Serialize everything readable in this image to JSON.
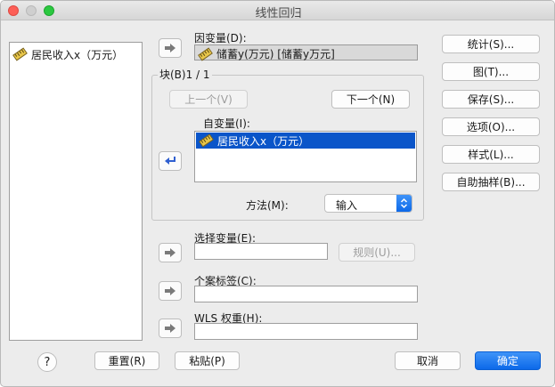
{
  "window": {
    "title": "线性回归"
  },
  "variable_list": {
    "items": [
      {
        "label": "居民收入x（万元）",
        "icon": "scale-ruler-icon"
      }
    ]
  },
  "dependent": {
    "label": "因变量(D):",
    "value": "储蓄y(万元) [储蓄y万元]",
    "icon": "scale-ruler-icon"
  },
  "block": {
    "title": "块(B)1 / 1",
    "prev_label": "上一个(V)",
    "next_label": "下一个(N)",
    "independent_label": "自变量(I):",
    "independent_items": [
      {
        "label": "居民收入x（万元）",
        "icon": "scale-ruler-icon"
      }
    ],
    "method_label": "方法(M):",
    "method_value": "输入"
  },
  "selection": {
    "label": "选择变量(E):",
    "rule_label": "规则(U)..."
  },
  "case_label": {
    "label": "个案标签(C):"
  },
  "wls": {
    "label": "WLS 权重(H):"
  },
  "side_buttons": {
    "statistics": "统计(S)...",
    "plots": "图(T)...",
    "save": "保存(S)...",
    "options": "选项(O)...",
    "style": "样式(L)...",
    "bootstrap": "自助抽样(B)..."
  },
  "footer": {
    "help": "?",
    "reset": "重置(R)",
    "paste": "粘贴(P)",
    "cancel": "取消",
    "ok": "确定"
  },
  "colors": {
    "accent": "#0c69e9",
    "selection": "#0a55c9",
    "window_bg": "#ececec"
  }
}
